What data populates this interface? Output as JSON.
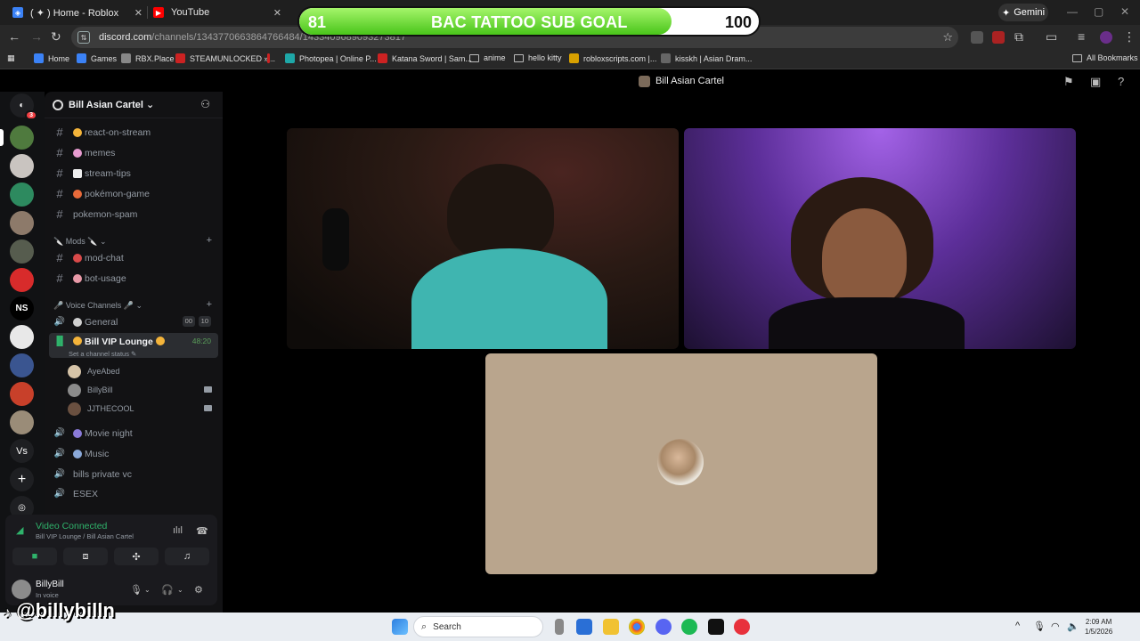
{
  "browser": {
    "tabs": [
      {
        "title": "( ✦ ) Home - Roblox",
        "color": "#3b82f6"
      },
      {
        "title": "YouTube",
        "color": "#ff0000"
      }
    ],
    "gemini_label": "Gemini",
    "url_main": "discord.com",
    "url_rest": "/channels/1343770663864766484/1433409689093273817",
    "bookmarks": [
      "Home",
      "Games",
      "RBX.Place",
      "STEAMUNLOCKED »...",
      "Photopea | Online P...",
      "Katana Sword | Sam...",
      "anime",
      "hello kitty",
      "robloxscripts.com |...",
      "kisskh | Asian Dram..."
    ],
    "all_bookmarks": "All Bookmarks"
  },
  "sub_goal": {
    "current": "81",
    "title": "BAC TATTOO SUB GOAL",
    "goal": "100",
    "progress_fraction": 0.81
  },
  "discord": {
    "window_title": "Bill Asian Cartel",
    "rail_badge": "3",
    "rail_vs_label": "Vs",
    "rail_ns_label": "NS",
    "guild_name": "Bill Asian Cartel",
    "text_channels": [
      "react-on-stream",
      "memes",
      "stream-tips",
      "pokémon-game",
      "pokemon-spam"
    ],
    "mods_category": "Mods",
    "mod_channels": [
      "mod-chat",
      "bot-usage"
    ],
    "voice_category": "Voice Channels",
    "voice_general": {
      "name": "General",
      "pill_a": "00",
      "pill_b": "10"
    },
    "voice_vip": {
      "name": "Bill VIP Lounge",
      "timer": "48:20",
      "status": "Set a channel status"
    },
    "voice_users": [
      "AyeAbed",
      "BillyBill",
      "JJTHECOOL"
    ],
    "other_voice": [
      "Movie night",
      "Music",
      "bills private vc",
      "ESEX"
    ],
    "panel": {
      "connected": "Video Connected",
      "location": "Bill VIP Lounge / Bill Asian Cartel",
      "username": "BillyBill",
      "user_status": "In voice"
    }
  },
  "watermark": "@billybilln",
  "taskbar": {
    "search_placeholder": "Search",
    "time": "2:09 AM",
    "date": "1/5/2026"
  }
}
